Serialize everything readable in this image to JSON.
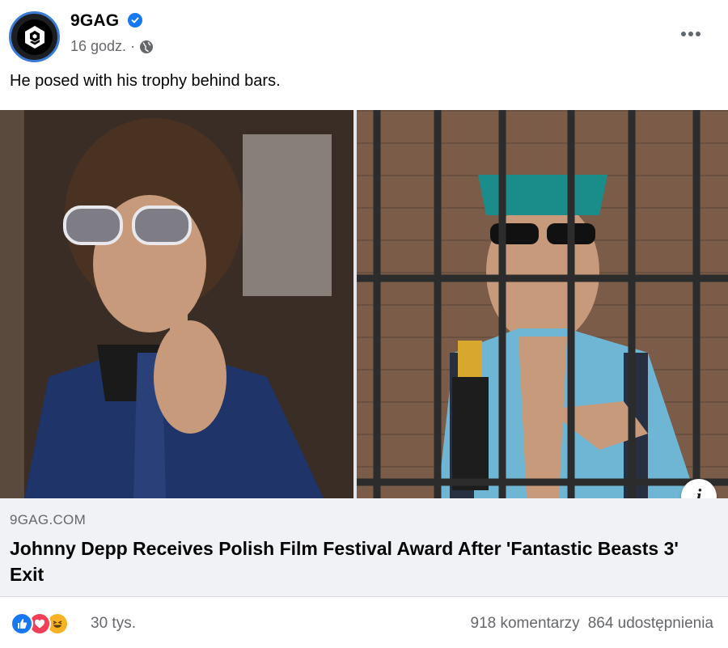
{
  "post": {
    "page_name": "9GAG",
    "time": "16 godz.",
    "separator": "·",
    "caption": "He posed with his trophy behind bars."
  },
  "link": {
    "domain": "9GAG.COM",
    "title": "Johnny Depp Receives Polish Film Festival Award After 'Fantastic Beasts 3' Exit"
  },
  "footer": {
    "reaction_count": "30 tys.",
    "comments": "918 komentarzy",
    "shares": "864 udostępnienia"
  },
  "colors": {
    "accent": "#1877f2",
    "like": "#1877f2",
    "love": "#f33e58",
    "haha": "#f7b125"
  },
  "icons": [
    "9gag-logo-icon",
    "verified-badge-icon",
    "globe-icon",
    "more-options-icon",
    "info-icon",
    "like-reaction-icon",
    "love-reaction-icon",
    "haha-reaction-icon"
  ]
}
